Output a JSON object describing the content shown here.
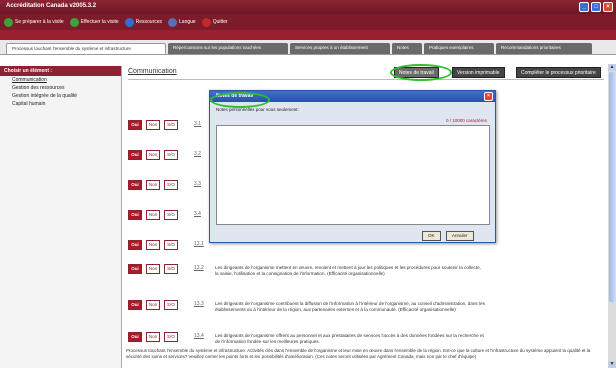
{
  "window": {
    "title": "Accréditation Canada v2005.3.2"
  },
  "toolbar": {
    "items": [
      {
        "label": "Se préparer à la visite",
        "icon": "green-arrow-icon",
        "color": "#3aa33a"
      },
      {
        "label": "Effectuer la visite",
        "icon": "green-arrow-icon",
        "color": "#3aa33a"
      },
      {
        "label": "Ressources",
        "icon": "help-icon",
        "color": "#2f6ed3"
      },
      {
        "label": "Langue",
        "icon": "speech-bubble-icon",
        "color": "#5a6fb0"
      },
      {
        "label": "Quitter",
        "icon": "exit-icon",
        "color": "#c02a2a"
      }
    ]
  },
  "tabs": [
    "Processus touchant l'ensemble du système et infrastructure",
    "Répercussions sur les populations touchées",
    "Services propres à un établissement",
    "Notes",
    "Pratiques exemplaires",
    "Recommandations prioritaires"
  ],
  "left_pane": {
    "heading": "Choisir un élément :",
    "items": [
      "Communication",
      "Gestion des ressources",
      "Gestion intégrée de la qualité",
      "Capital humain"
    ]
  },
  "main": {
    "section_title": "Communication",
    "buttons": {
      "notes": "Notes de travail",
      "print": "Version imprimable",
      "complete": "Compléter le processus prioritaire"
    },
    "answer_labels": {
      "yes": "Oui",
      "no": "Non",
      "na": "S/O"
    },
    "rows": [
      {
        "num": "3.1",
        "text": ""
      },
      {
        "num": "3.2",
        "text": ""
      },
      {
        "num": "3.3",
        "text": ""
      },
      {
        "num": "3.4",
        "text": ""
      },
      {
        "num": "13.1",
        "text": ""
      },
      {
        "num": "13.2",
        "text": "Les dirigeants de l'organisme mettent en œuvre, revoient et mettent à jour les politiques et les procédures pour soutenir la collecte, la saisie, l'utilisation et la consignation de l'information. (Efficacité organisationnelle)"
      },
      {
        "num": "13.3",
        "text": "Les dirigeants de l'organisme contribuent la diffusion de l'information à l'intérieur de l'organisme, au conseil d'administration, dans les établissements ou à l'intérieur de la région, aux partenaires externes et à la communauté. (Efficacité organisationnelle)"
      },
      {
        "num": "13.4",
        "text": "Les dirigeants de l'organisme offrent au personnel et aux prestataires de services l'accès à des données fondées sur la recherche et de l'information fondée sur les meilleures pratiques."
      }
    ],
    "footer_text": "Processus touchant l'ensemble du système et infrastructure. Activités clés dans l'ensemble de l'organisme et leur mise en œuvre dans l'ensemble de la région. Est-ce que la culture et l'infrastructure du système appuient la qualité et la sécurité des soins et services? Veuillez cerner les points forts et les possibilités d'amélioration. (Ces notes seront utilisées par Agrément Canada, mais non par le chef d'équipe)"
  },
  "dialog": {
    "title": "Notes de travail",
    "label": "Notes personnelles pour vous seulement:",
    "counter": "0 / 10000 caractères",
    "ok": "OK",
    "cancel": "Annuler"
  }
}
